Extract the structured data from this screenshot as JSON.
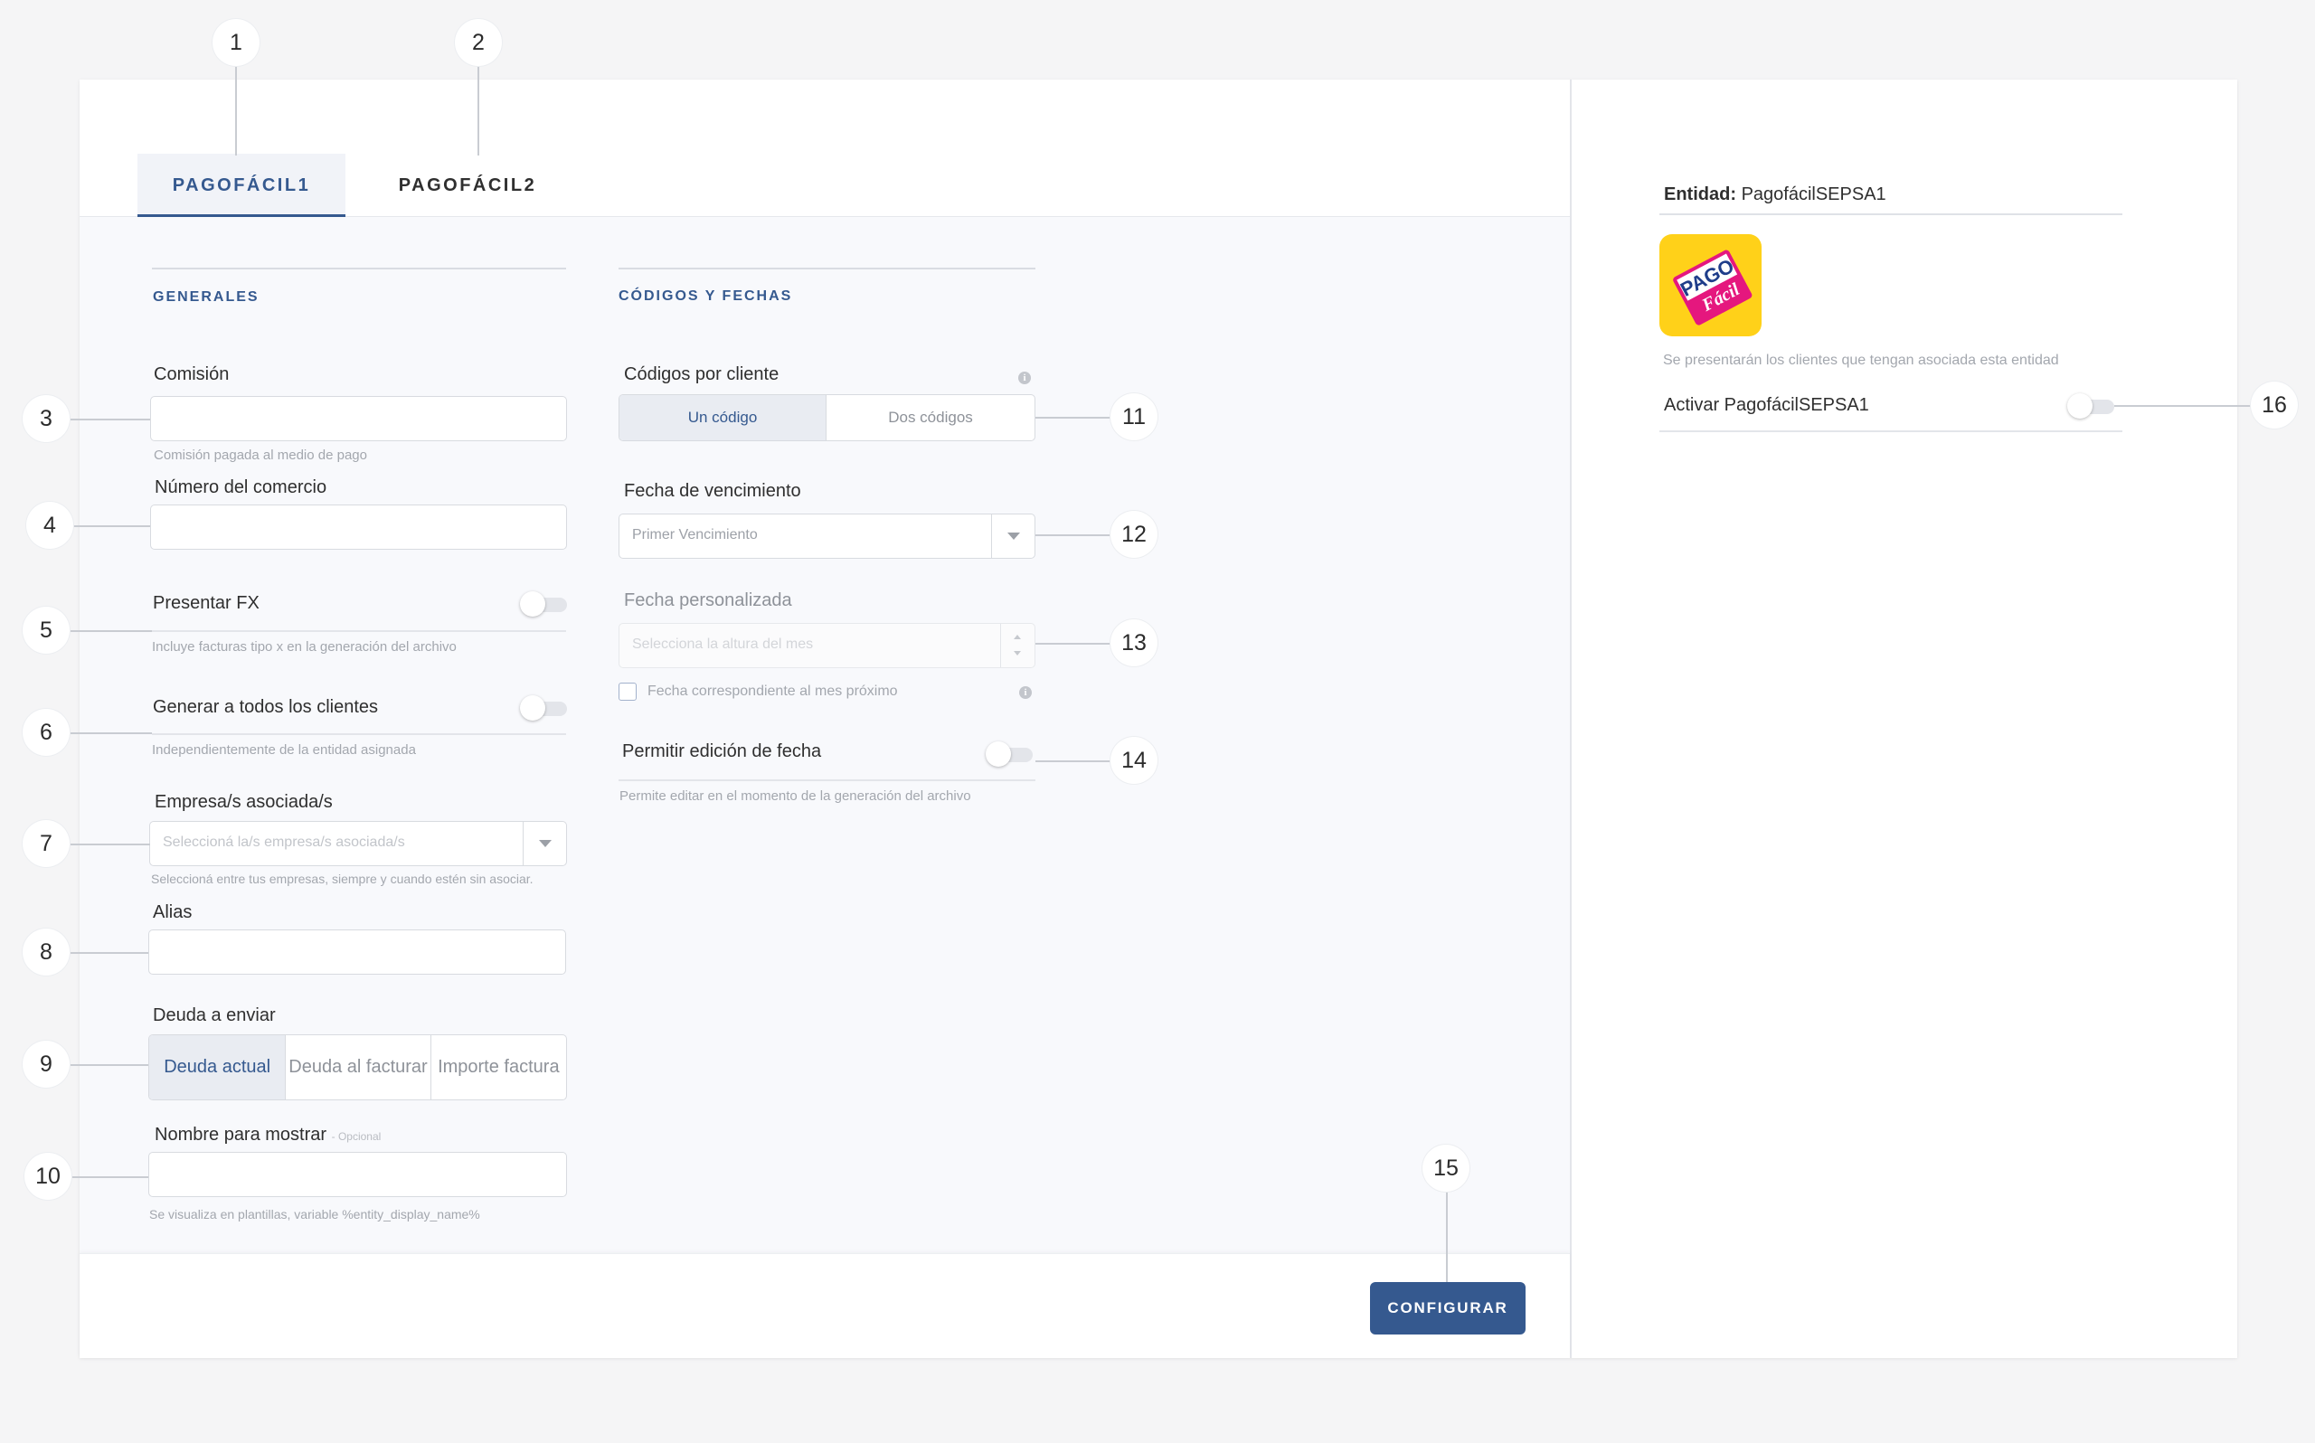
{
  "tabs": [
    {
      "label": "PAGOFÁCIL1",
      "active": true
    },
    {
      "label": "PAGOFÁCIL2",
      "active": false
    }
  ],
  "generales": {
    "title": "GENERALES",
    "comision": {
      "label": "Comisión",
      "value": "",
      "help": "Comisión pagada al medio de pago"
    },
    "numero_comercio": {
      "label": "Número del comercio",
      "value": ""
    },
    "presentar_fx": {
      "label": "Presentar FX",
      "on": false,
      "help": "Incluye facturas tipo x en la generación del archivo"
    },
    "generar_todos": {
      "label": "Generar a todos los clientes",
      "on": false,
      "help": "Independientemente de la entidad asignada"
    },
    "empresas": {
      "label": "Empresa/s asociada/s",
      "placeholder": "Seleccioná la/s empresa/s asociada/s",
      "help": "Seleccioná entre tus empresas, siempre y cuando estén sin asociar."
    },
    "alias": {
      "label": "Alias",
      "value": ""
    },
    "deuda": {
      "label": "Deuda a enviar",
      "options": [
        "Deuda actual",
        "Deuda al facturar",
        "Importe factura"
      ],
      "selected": "Deuda actual"
    },
    "nombre_mostrar": {
      "label": "Nombre para mostrar",
      "optional": "- Opcional",
      "value": "",
      "help": "Se visualiza en plantillas, variable %entity_display_name%"
    }
  },
  "codigos": {
    "title": "CÓDIGOS Y FECHAS",
    "codigos_cliente": {
      "label": "Códigos por cliente",
      "options": [
        "Un código",
        "Dos códigos"
      ],
      "selected": "Un código"
    },
    "fecha_vencimiento": {
      "label": "Fecha de vencimiento",
      "value": "Primer Vencimiento"
    },
    "fecha_personalizada": {
      "label": "Fecha personalizada",
      "placeholder": "Selecciona la altura del mes"
    },
    "mes_proximo": {
      "label": "Fecha correspondiente al mes próximo",
      "checked": false
    },
    "permitir_edicion": {
      "label": "Permitir edición de fecha",
      "on": false,
      "help": "Permite editar en el momento de la generación del archivo"
    }
  },
  "footer": {
    "configurar_label": "CONFIGURAR"
  },
  "entidad": {
    "label": "Entidad:",
    "name": "PagofácilSEPSA1",
    "logo_text_top": "PAGO",
    "logo_text_bottom": "Fácil",
    "description": "Se presentarán los clientes que tengan asociada esta entidad",
    "activar": {
      "label": "Activar PagofácilSEPSA1",
      "on": false
    }
  },
  "callouts": [
    "1",
    "2",
    "3",
    "4",
    "5",
    "6",
    "7",
    "8",
    "9",
    "10",
    "11",
    "12",
    "13",
    "14",
    "15",
    "16"
  ],
  "colors": {
    "accent": "#35598f",
    "logo_bg": "#ffd119",
    "logo_pink": "#e5177e",
    "logo_blue": "#1f3d8a"
  }
}
